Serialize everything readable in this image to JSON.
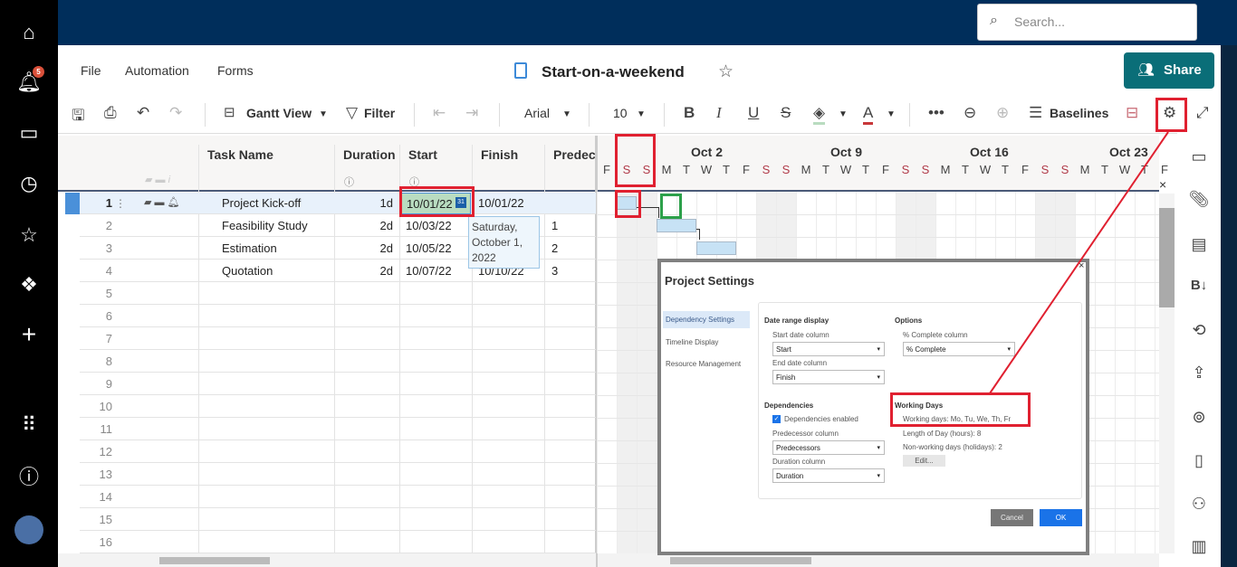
{
  "nav": {
    "notifications_count": "5",
    "items": [
      "home",
      "notifications",
      "browse",
      "recents",
      "favorites",
      "solutions",
      "create",
      "launcher",
      "help",
      "account"
    ]
  },
  "search": {
    "placeholder": "Search..."
  },
  "menu": {
    "file": "File",
    "automation": "Automation",
    "forms": "Forms"
  },
  "sheet": {
    "title": "Start-on-a-weekend"
  },
  "share": {
    "label": "Share"
  },
  "toolbar": {
    "view": "Gantt View",
    "filter": "Filter",
    "font": "Arial",
    "size": "10",
    "baselines": "Baselines"
  },
  "grid": {
    "headers": {
      "task": "Task Name",
      "duration": "Duration",
      "start": "Start",
      "finish": "Finish",
      "predecessors": "Predece"
    },
    "rows": [
      {
        "n": "1",
        "task": "Project Kick-off",
        "duration": "1d",
        "start": "10/01/22",
        "finish": "10/01/22",
        "pred": ""
      },
      {
        "n": "2",
        "task": "Feasibility Study",
        "duration": "2d",
        "start": "10/03/22",
        "finish": "",
        "pred": "1"
      },
      {
        "n": "3",
        "task": "Estimation",
        "duration": "2d",
        "start": "10/05/22",
        "finish": "",
        "pred": "2"
      },
      {
        "n": "4",
        "task": "Quotation",
        "duration": "2d",
        "start": "10/07/22",
        "finish": "10/10/22",
        "pred": "3"
      },
      {
        "n": "5"
      },
      {
        "n": "6"
      },
      {
        "n": "7"
      },
      {
        "n": "8"
      },
      {
        "n": "9"
      },
      {
        "n": "10"
      },
      {
        "n": "11"
      },
      {
        "n": "12"
      },
      {
        "n": "13"
      },
      {
        "n": "14"
      },
      {
        "n": "15"
      },
      {
        "n": "16"
      }
    ],
    "tooltip": "Saturday, October 1, 2022"
  },
  "gantt": {
    "weeks": [
      "Oct 2",
      "Oct 9",
      "Oct 16",
      "Oct 23"
    ],
    "days": [
      "F",
      "S",
      "S",
      "M",
      "T",
      "W",
      "T",
      "F",
      "S",
      "S",
      "M",
      "T",
      "W",
      "T",
      "F",
      "S",
      "S",
      "M",
      "T",
      "W",
      "T",
      "F",
      "S",
      "S",
      "M",
      "T",
      "W",
      "T",
      "F"
    ],
    "close": "×"
  },
  "dialog": {
    "title": "Project Settings",
    "close": "×",
    "tabs": [
      "Dependency Settings",
      "Timeline Display",
      "Resource Management"
    ],
    "date_range": "Date range display",
    "start_col_label": "Start date column",
    "start_col": "Start",
    "end_col_label": "End date column",
    "end_col": "Finish",
    "options": "Options",
    "pct_label": "% Complete column",
    "pct": "% Complete",
    "dependencies": "Dependencies",
    "dep_enabled": "Dependencies enabled",
    "pred_label": "Predecessor column",
    "pred": "Predecessors",
    "dur_label": "Duration column",
    "dur": "Duration",
    "working_days_title": "Working Days",
    "working_days": "Working days: Mo, Tu, We, Th, Fr",
    "length": "Length of Day (hours): 8",
    "holidays": "Non-working days (holidays): 2",
    "edit": "Edit...",
    "cancel": "Cancel",
    "ok": "OK"
  },
  "colors": {
    "topbar": "#002e5b",
    "share": "#0a6e78",
    "highlight": "#e02030",
    "ok": "#1a73e8"
  }
}
